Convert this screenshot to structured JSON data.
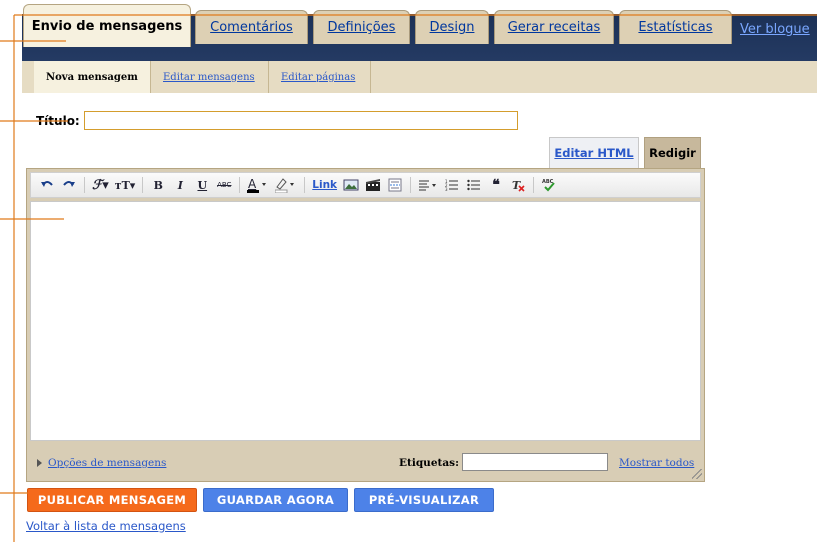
{
  "tabs": {
    "posting": "Envio de mensagens",
    "comments": "Comentários",
    "settings": "Definições",
    "design": "Design",
    "monetize": "Gerar receitas",
    "stats": "Estatísticas",
    "view_blog": "Ver blogue"
  },
  "subtabs": {
    "new_post": "Nova mensagem",
    "edit_posts": "Editar mensagens",
    "edit_pages": "Editar páginas"
  },
  "title_label": "Título:",
  "title_value": "",
  "mode": {
    "html": "Editar HTML",
    "compose": "Redigir"
  },
  "toolbar": {
    "link": "Link"
  },
  "post_options": "Opções de mensagens",
  "labels_label": "Etiquetas:",
  "labels_value": "",
  "show_all": "Mostrar todos",
  "buttons": {
    "publish": "PUBLICAR MENSAGEM",
    "save": "GUARDAR AGORA",
    "preview": "PRÉ-VISUALIZAR"
  },
  "back_link": "Voltar à lista de mensagens",
  "colors": {
    "accent_orange": "#f56a1b",
    "button_blue": "#4d82e8",
    "nav_dark": "#1c3156",
    "tab_beige": "#ddd0b4",
    "callout_orange": "#e07a1a"
  }
}
